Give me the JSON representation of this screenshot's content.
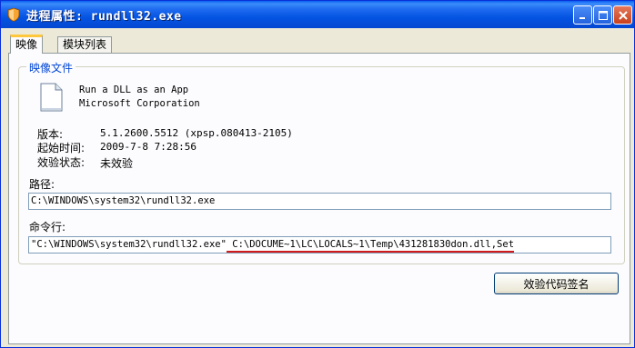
{
  "window": {
    "title": "进程属性: rundll32.exe",
    "title_icon": "shield-icon"
  },
  "tabs": [
    {
      "label": "映像",
      "active": true
    },
    {
      "label": "模块列表",
      "active": false
    }
  ],
  "image_group": {
    "label": "映像文件",
    "file_icon": "document-icon",
    "description": "Run a DLL as an App",
    "company": "Microsoft Corporation",
    "info": [
      {
        "label": "版本:",
        "value": "5.1.2600.5512 (xpsp.080413-2105)"
      },
      {
        "label": "起始时间:",
        "value": "2009-7-8 7:28:56"
      },
      {
        "label": "效验状态:",
        "value": "未效验"
      }
    ],
    "path_label": "路径:",
    "path_value": "C:\\WINDOWS\\system32\\rundll32.exe",
    "cmd_label": "命令行:",
    "cmd_part1": "\"C:\\WINDOWS\\system32\\rundll32.exe\"",
    "cmd_part2": " C:\\DOCUME~1\\LC\\LOCALS~1\\Temp\\431281830don.dll,Set"
  },
  "buttons": {
    "verify_signature": "效验代码签名"
  },
  "colors": {
    "titlebar": "#0554e3",
    "group_label": "#0046d5",
    "highlight_underline": "#d21a1a",
    "tab_accent": "#ffc83c"
  }
}
